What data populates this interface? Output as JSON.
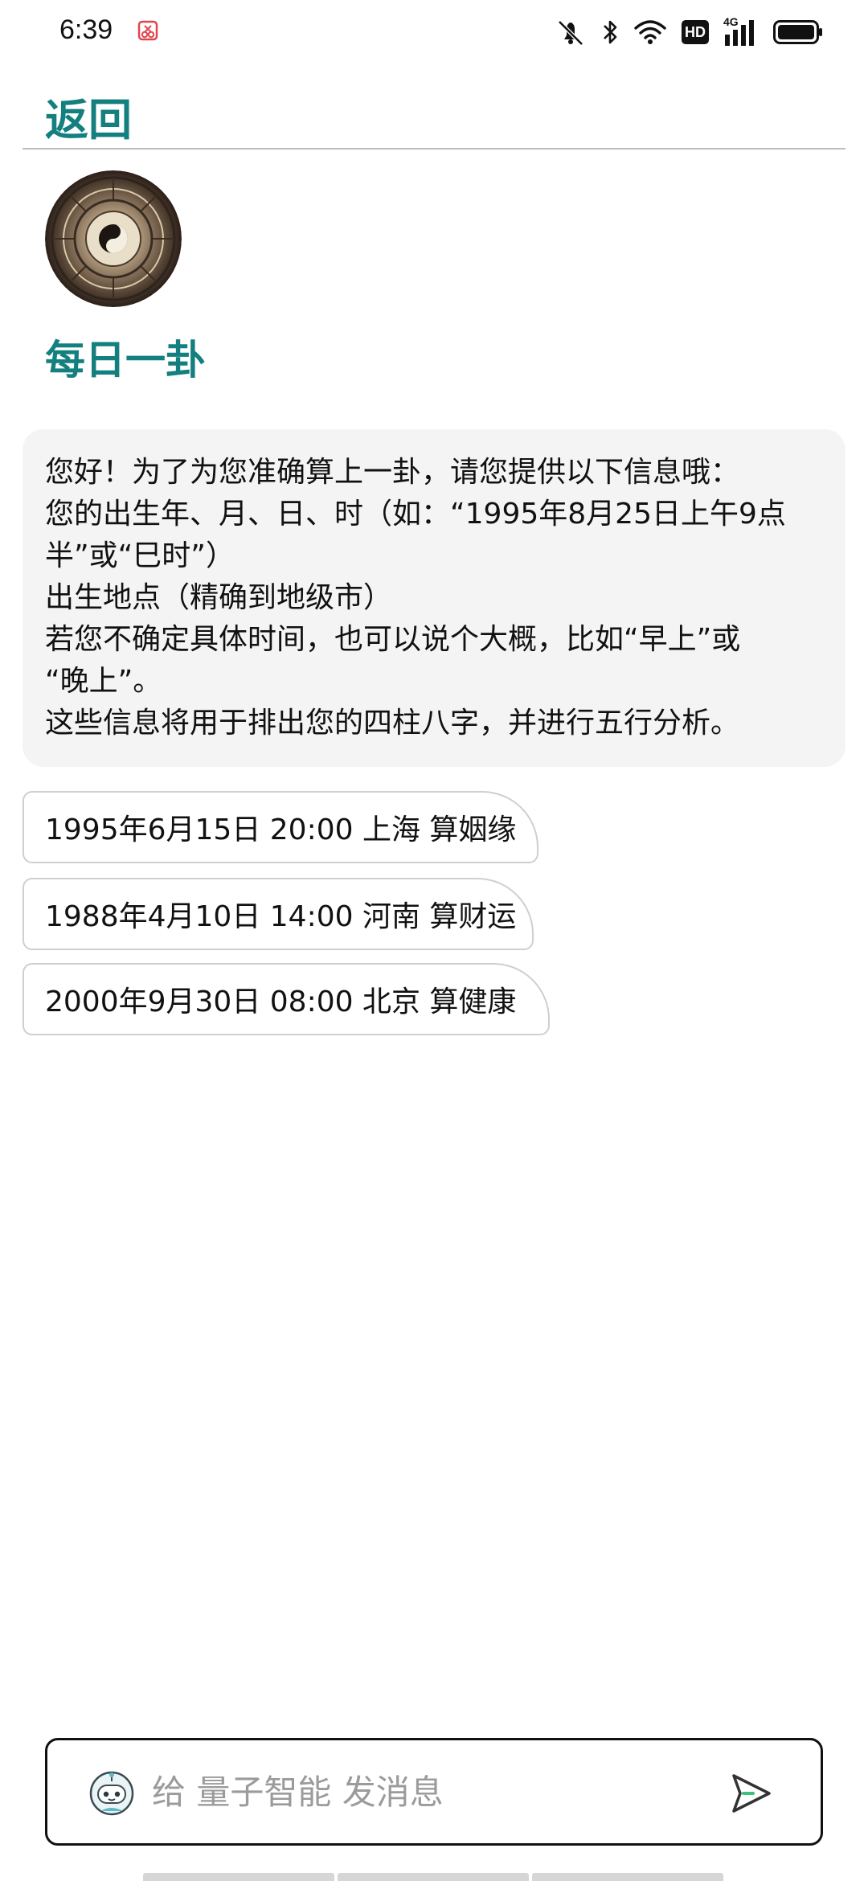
{
  "status_bar": {
    "time": "6:39",
    "icons": [
      "screen-record-icon",
      "mute-icon",
      "bluetooth-icon",
      "wifi-icon",
      "hd-icon",
      "4g-signal-icon",
      "battery-icon"
    ],
    "hd_label": "HD",
    "network_label": "4G"
  },
  "header": {
    "back_label": "返回"
  },
  "bot": {
    "name": "每日一卦",
    "avatar_icon": "bagua-compass-avatar"
  },
  "greeting": {
    "lines": [
      "您好！为了为您准确算上一卦，请您提供以下信息哦：",
      "您的出生年、月、日、时（如：“1995年8月25日上午9点",
      "半”或“巳时”）",
      "出生地点（精确到地级市）",
      "若您不确定具体时间，也可以说个大概，比如“早上”或",
      "“晚上”。",
      "这些信息将用于排出您的四柱八字，并进行五行分析。"
    ]
  },
  "suggestions": [
    {
      "label": "1995年6月15日 20:00 上海 算姻缘"
    },
    {
      "label": "1988年4月10日 14:00 河南 算财运"
    },
    {
      "label": "2000年9月30日 08:00 北京 算健康"
    }
  ],
  "composer": {
    "placeholder": "给 量子智能 发消息",
    "value": "",
    "robot_icon": "robot-icon",
    "send_icon": "send-icon"
  },
  "colors": {
    "accent": "#137f7f",
    "bubble_bg": "#f4f4f4",
    "chip_border": "#cfcfcf",
    "placeholder": "#9b9b9b"
  }
}
